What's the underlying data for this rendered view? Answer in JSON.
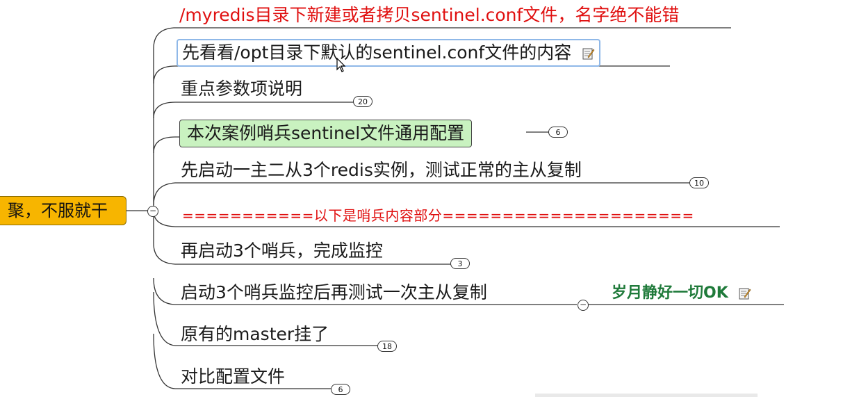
{
  "root": {
    "label": "聚，不服就干"
  },
  "topics": [
    {
      "label": "/myredis目录下新建或者拷贝sentinel.conf文件，名字绝不能错"
    },
    {
      "label": "先看看/opt目录下默认的sentinel.conf文件的内容",
      "icon": "note-icon"
    },
    {
      "label": "重点参数项说明",
      "badge": "20"
    },
    {
      "label": "本次案例哨兵sentinel文件通用配置",
      "badge": "6"
    },
    {
      "label": "先启动一主二从3个redis实例，测试正常的主从复制",
      "badge": "10"
    },
    {
      "label": "===========以下是哨兵内容部分====================="
    },
    {
      "label": "再启动3个哨兵，完成监控",
      "badge": "3"
    },
    {
      "label": "启动3个哨兵监控后再测试一次主从复制",
      "child": "岁月静好一切OK",
      "child_icon": "note-icon"
    },
    {
      "label": "原有的master挂了",
      "badge": "18"
    },
    {
      "label": "对比配置文件",
      "badge": "6"
    }
  ],
  "collapse_symbol": "−",
  "colors": {
    "root_fill": "#f7b500",
    "highlight_fill": "#c9f2c0",
    "red_text": "#e01010",
    "ok_text": "#1f7a3a",
    "selection_border": "#8fb8e8"
  }
}
